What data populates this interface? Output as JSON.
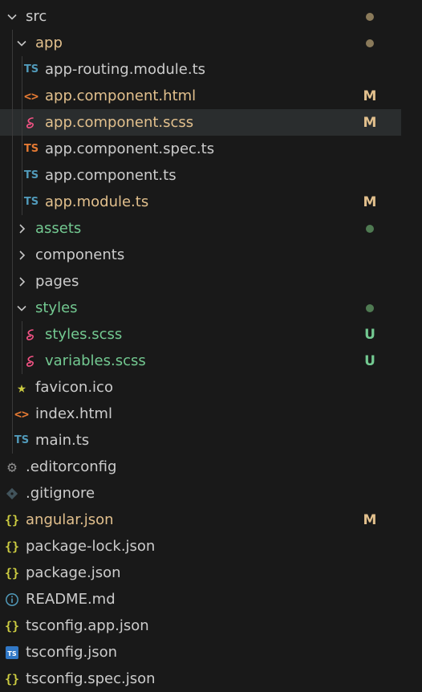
{
  "explorer": {
    "colors": {
      "modified": "#e2c08d",
      "untracked": "#73c991",
      "default": "#cccccc",
      "dot_modified": "#8a7a5a",
      "dot_untracked": "#4f7a52"
    },
    "rows": [
      {
        "label": "src",
        "depth": 0,
        "kind": "folder-open",
        "icon": "chevron-down-icon",
        "color": "default",
        "badge": "",
        "dot": "dot_modified"
      },
      {
        "label": "app",
        "depth": 1,
        "kind": "folder-open",
        "icon": "chevron-down-icon",
        "color": "modified",
        "badge": "",
        "dot": "dot_modified"
      },
      {
        "label": "app-routing.module.ts",
        "depth": 2,
        "kind": "file",
        "icon": "typescript-icon",
        "color": "default",
        "badge": "",
        "dot": ""
      },
      {
        "label": "app.component.html",
        "depth": 2,
        "kind": "file",
        "icon": "html-icon",
        "color": "modified",
        "badge": "M",
        "dot": ""
      },
      {
        "label": "app.component.scss",
        "depth": 2,
        "kind": "file",
        "icon": "sass-icon",
        "color": "modified",
        "badge": "M",
        "dot": "",
        "selected": true
      },
      {
        "label": "app.component.spec.ts",
        "depth": 2,
        "kind": "file",
        "icon": "typescript-test-icon",
        "color": "default",
        "badge": "",
        "dot": ""
      },
      {
        "label": "app.component.ts",
        "depth": 2,
        "kind": "file",
        "icon": "typescript-icon",
        "color": "default",
        "badge": "",
        "dot": ""
      },
      {
        "label": "app.module.ts",
        "depth": 2,
        "kind": "file",
        "icon": "typescript-icon",
        "color": "modified",
        "badge": "M",
        "dot": ""
      },
      {
        "label": "assets",
        "depth": 1,
        "kind": "folder-closed",
        "icon": "chevron-right-icon",
        "color": "untracked",
        "badge": "",
        "dot": "dot_untracked"
      },
      {
        "label": "components",
        "depth": 1,
        "kind": "folder-closed",
        "icon": "chevron-right-icon",
        "color": "default",
        "badge": "",
        "dot": ""
      },
      {
        "label": "pages",
        "depth": 1,
        "kind": "folder-closed",
        "icon": "chevron-right-icon",
        "color": "default",
        "badge": "",
        "dot": ""
      },
      {
        "label": "styles",
        "depth": 1,
        "kind": "folder-open",
        "icon": "chevron-down-icon",
        "color": "untracked",
        "badge": "",
        "dot": "dot_untracked"
      },
      {
        "label": "styles.scss",
        "depth": 2,
        "kind": "file",
        "icon": "sass-icon",
        "color": "untracked",
        "badge": "U",
        "dot": ""
      },
      {
        "label": "variables.scss",
        "depth": 2,
        "kind": "file",
        "icon": "sass-icon",
        "color": "untracked",
        "badge": "U",
        "dot": ""
      },
      {
        "label": "favicon.ico",
        "depth": 1,
        "kind": "file",
        "icon": "star-icon",
        "color": "default",
        "badge": "",
        "dot": ""
      },
      {
        "label": "index.html",
        "depth": 1,
        "kind": "file",
        "icon": "html-icon",
        "color": "default",
        "badge": "",
        "dot": ""
      },
      {
        "label": "main.ts",
        "depth": 1,
        "kind": "file",
        "icon": "typescript-icon",
        "color": "default",
        "badge": "",
        "dot": ""
      },
      {
        "label": ".editorconfig",
        "depth": 0,
        "kind": "file",
        "icon": "gear-icon",
        "color": "default",
        "badge": "",
        "dot": ""
      },
      {
        "label": ".gitignore",
        "depth": 0,
        "kind": "file",
        "icon": "git-icon",
        "color": "default",
        "badge": "",
        "dot": ""
      },
      {
        "label": "angular.json",
        "depth": 0,
        "kind": "file",
        "icon": "json-icon",
        "color": "modified",
        "badge": "M",
        "dot": ""
      },
      {
        "label": "package-lock.json",
        "depth": 0,
        "kind": "file",
        "icon": "json-icon",
        "color": "default",
        "badge": "",
        "dot": ""
      },
      {
        "label": "package.json",
        "depth": 0,
        "kind": "file",
        "icon": "json-icon",
        "color": "default",
        "badge": "",
        "dot": ""
      },
      {
        "label": "README.md",
        "depth": 0,
        "kind": "file",
        "icon": "info-icon",
        "color": "default",
        "badge": "",
        "dot": ""
      },
      {
        "label": "tsconfig.app.json",
        "depth": 0,
        "kind": "file",
        "icon": "json-icon",
        "color": "default",
        "badge": "",
        "dot": ""
      },
      {
        "label": "tsconfig.json",
        "depth": 0,
        "kind": "file",
        "icon": "tsconfig-icon",
        "color": "default",
        "badge": "",
        "dot": ""
      },
      {
        "label": "tsconfig.spec.json",
        "depth": 0,
        "kind": "file",
        "icon": "json-icon",
        "color": "default",
        "badge": "",
        "dot": ""
      }
    ]
  }
}
